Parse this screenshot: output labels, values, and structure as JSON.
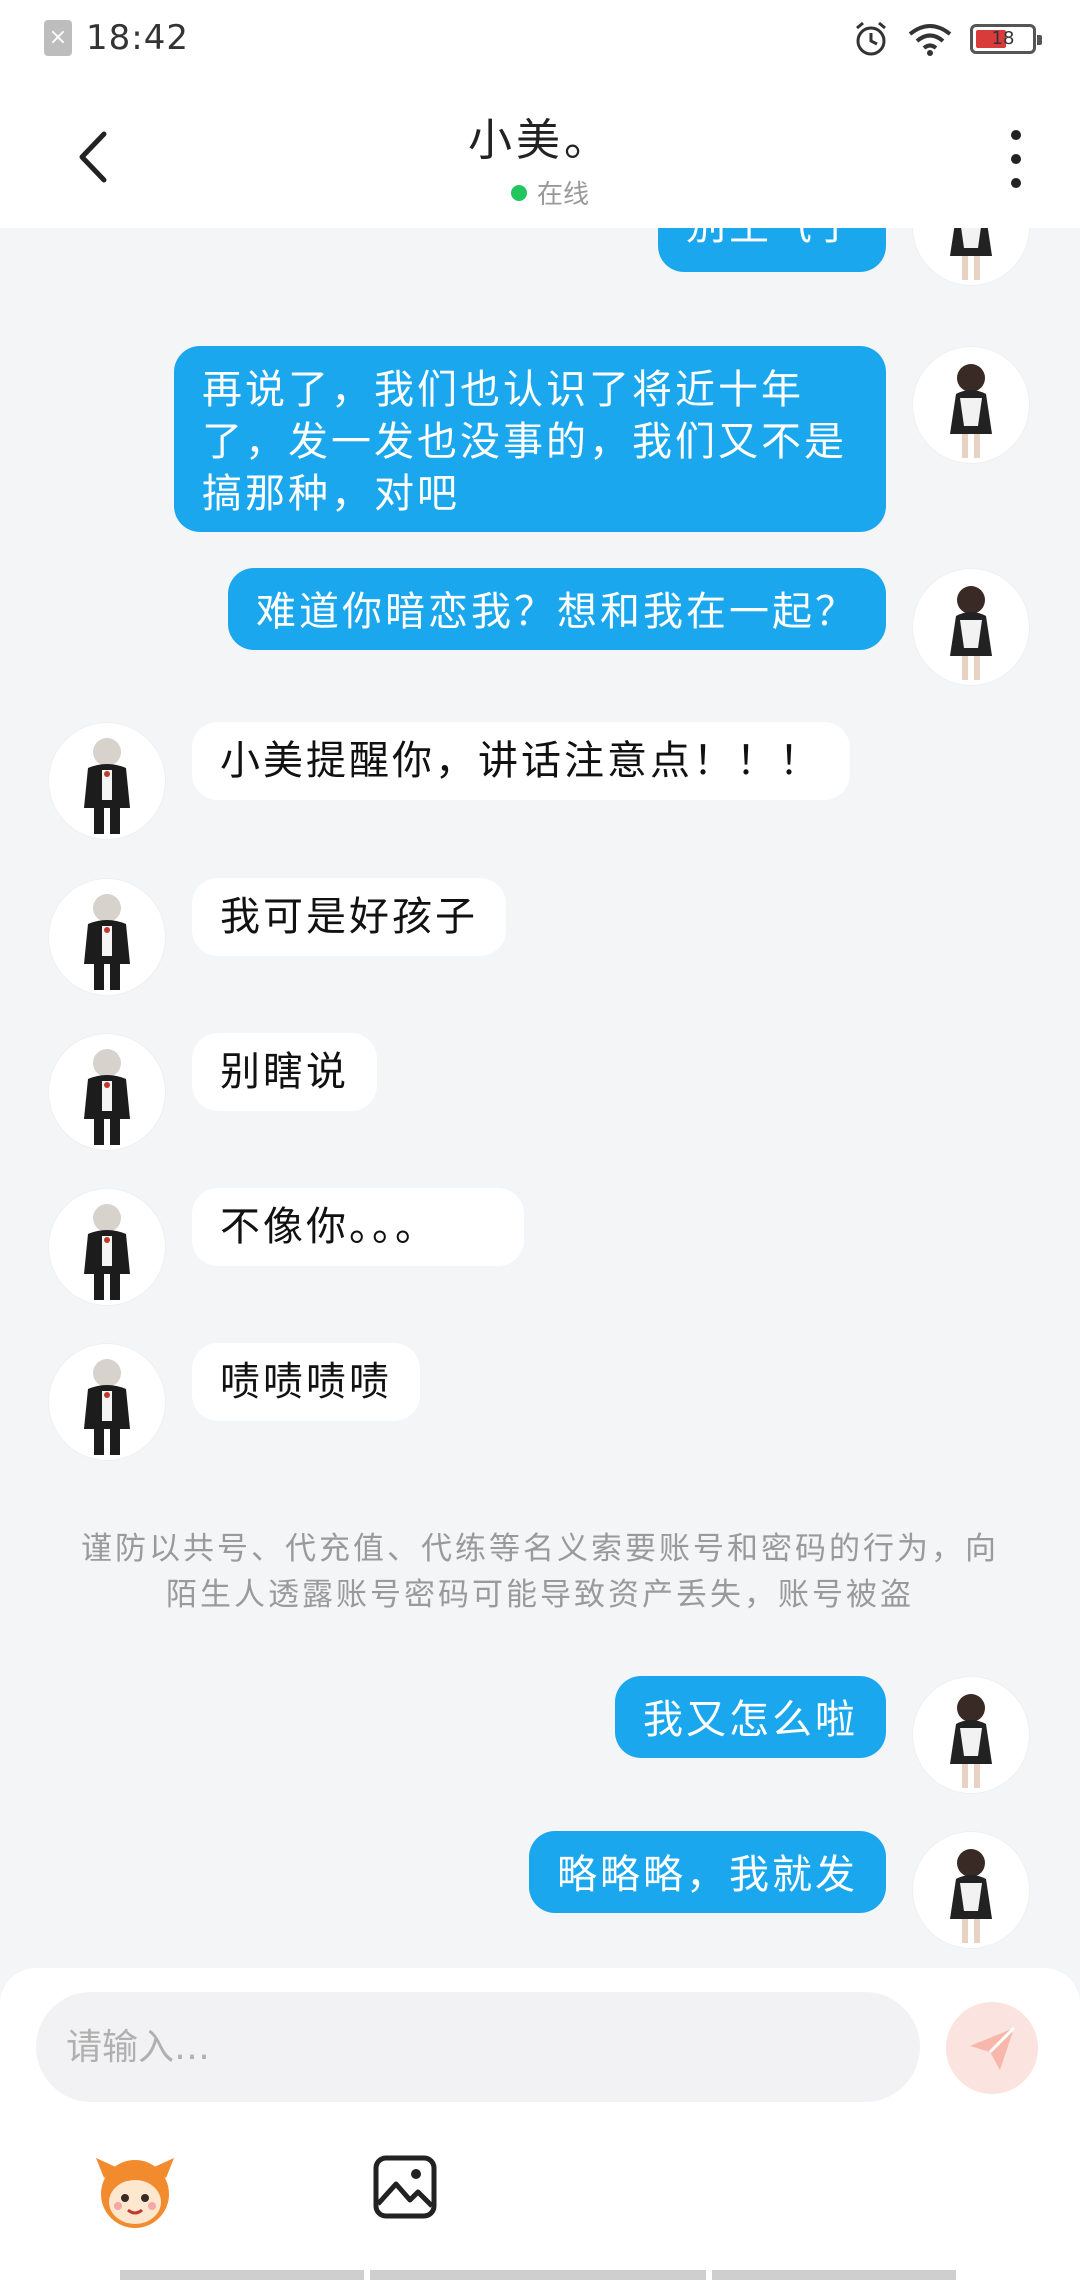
{
  "status_bar": {
    "time": "18:42",
    "battery": "18",
    "icons": [
      "sim-icon",
      "alarm-icon",
      "wifi-icon",
      "battery-icon"
    ]
  },
  "header": {
    "contact_name": "小美。",
    "status": "在线"
  },
  "messages": [
    {
      "from": "me",
      "text": "别生气了"
    },
    {
      "from": "me",
      "text": "再说了，我们也认识了将近十年了，发一发也没事的，我们又不是搞那种，对吧"
    },
    {
      "from": "me",
      "text": "难道你暗恋我？想和我在一起？"
    },
    {
      "from": "other",
      "text": "小美提醒你，讲话注意点！！！"
    },
    {
      "from": "other",
      "text": "我可是好孩子"
    },
    {
      "from": "other",
      "text": "别瞎说"
    },
    {
      "from": "other",
      "text": "不像你。。。"
    },
    {
      "from": "other",
      "text": "啧啧啧啧"
    },
    {
      "from": "me",
      "text": "我又怎么啦"
    },
    {
      "from": "me",
      "text": "略略略，我就发"
    }
  ],
  "notice": "谨防以共号、代充值、代练等名义索要账号和密码的行为，向陌生人透露账号密码可能导致资产丢失，账号被盗",
  "composer": {
    "placeholder": "请输入…"
  },
  "colors": {
    "my_bubble": "#1ba7ee",
    "other_bubble": "#ffffff",
    "online": "#22c55e",
    "send_button": "#fbe3df"
  }
}
